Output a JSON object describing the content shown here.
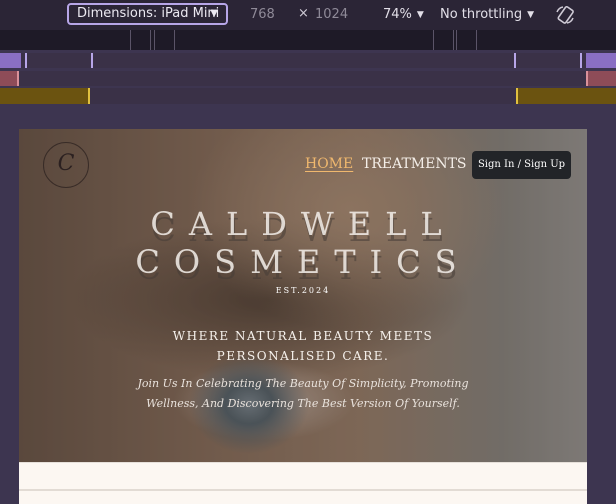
{
  "devtools": {
    "dimensions_label": "Dimensions: iPad Mini",
    "width": "768",
    "times": "×",
    "height": "1024",
    "zoom": "74%",
    "throttling": "No throttling",
    "rotate_icon": "rotate-icon"
  },
  "site": {
    "logo_text": "C",
    "nav": {
      "home": "HOME",
      "treatments": "TREATMENTS"
    },
    "signin": "Sign In / Sign Up",
    "brand_line1": "CALDWELL",
    "brand_line2": "COSMETICS",
    "est": "EST.2024",
    "tagline_line1": "WHERE NATURAL BEAUTY MEETS",
    "tagline_line2": "PERSONALISED CARE.",
    "subtitle_line1": "Join Us In Celebrating The Beauty Of Simplicity, Promoting",
    "subtitle_line2": "Wellness, And Discovering The Best Version Of Yourself."
  },
  "colors": {
    "toolbar_bg": "#2b2536",
    "select_border": "#b7a6e8",
    "nav_active": "#f0b86e",
    "signin_bg": "#222428",
    "mq_purple": "#8a6fc4",
    "mq_red": "#b9606c",
    "mq_gold": "#6b5310"
  }
}
